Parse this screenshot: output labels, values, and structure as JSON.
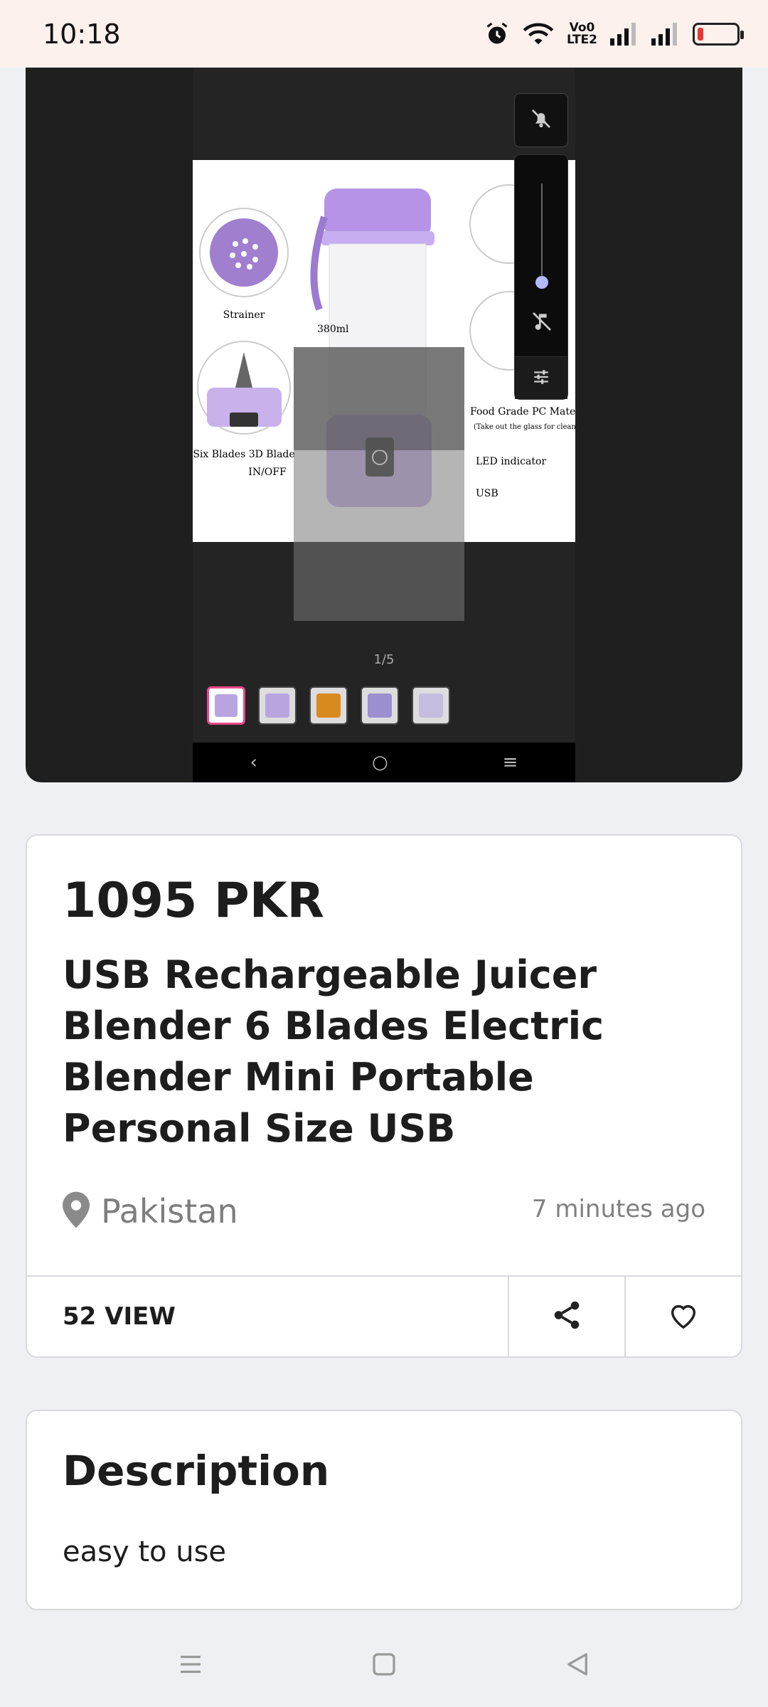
{
  "status_bar": {
    "time": "10:18",
    "volte_top": "Vo0",
    "volte_bottom": "LTE2",
    "battery_level": 0.15,
    "battery_color": "#e53935"
  },
  "gallery": {
    "page_counter": "1/5",
    "image_labels": [
      "Strainer",
      "380ml",
      "Six Blades 3D Blade",
      "IN/OFF",
      "Food Grade PC Material",
      "(Take out the glass for cleaning)",
      "LED indicator",
      "USB"
    ],
    "thumbnail_count": 5,
    "accent_color": "#e8478b"
  },
  "product": {
    "price": "1095 PKR",
    "title": "USB Rechargeable Juicer Blender 6 Blades Electric Blender Mini Portable Personal Size USB",
    "location": "Pakistan",
    "posted": "7 minutes ago",
    "views": "52 VIEW"
  },
  "description": {
    "heading": "Description",
    "text": "easy to use"
  },
  "icons": {
    "location": "map-pin-icon",
    "share": "share-icon",
    "favorite": "heart-icon",
    "nav_menu": "menu-icon",
    "nav_home": "square-home-icon",
    "nav_back": "triangle-back-icon"
  }
}
